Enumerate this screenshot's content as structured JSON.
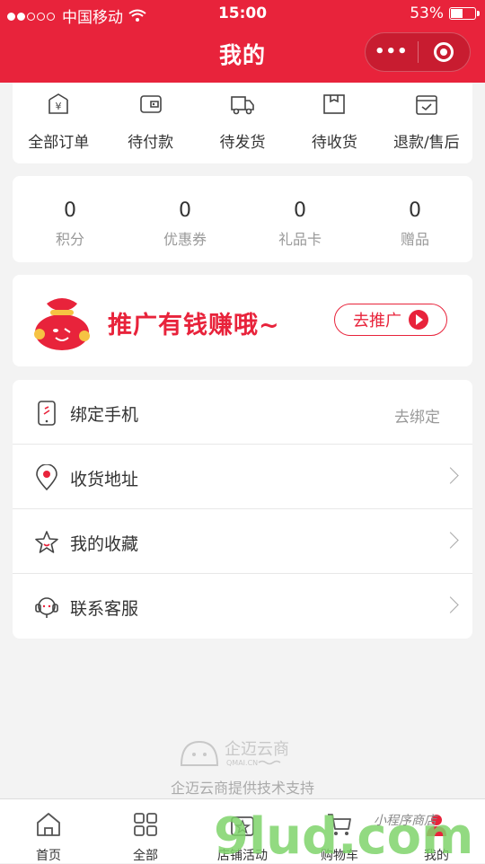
{
  "status_bar": {
    "carrier": "中国移动",
    "time": "15:00",
    "battery": "53%",
    "battery_level": 0.53
  },
  "nav": {
    "title": "我的"
  },
  "orders": [
    {
      "label": "全部订单",
      "icon": "yen-icon"
    },
    {
      "label": "待付款",
      "icon": "wallet-icon"
    },
    {
      "label": "待发货",
      "icon": "truck-icon"
    },
    {
      "label": "待收货",
      "icon": "box-icon"
    },
    {
      "label": "退款/售后",
      "icon": "calendar-check-icon"
    }
  ],
  "assets": [
    {
      "value": "0",
      "label": "积分"
    },
    {
      "value": "0",
      "label": "优惠券"
    },
    {
      "value": "0",
      "label": "礼品卡"
    },
    {
      "value": "0",
      "label": "赠品"
    }
  ],
  "promo": {
    "text": "推广有钱赚哦~",
    "button": "去推广"
  },
  "menu": [
    {
      "label": "绑定手机",
      "right_text": "去绑定",
      "icon": "phone-icon"
    },
    {
      "label": "收货地址",
      "icon": "location-pin-icon"
    },
    {
      "label": "我的收藏",
      "icon": "star-icon"
    },
    {
      "label": "联系客服",
      "icon": "headset-icon"
    }
  ],
  "footer": {
    "logo_text": "企迈云商",
    "logo_sub": "QMAI.CN",
    "support": "企迈云商提供技术支持"
  },
  "tabbar": [
    {
      "label": "首页",
      "icon": "home-icon"
    },
    {
      "label": "全部",
      "icon": "grid-icon"
    },
    {
      "label": "店铺活动",
      "icon": "store-activity-icon"
    },
    {
      "label": "购物车",
      "icon": "cart-icon"
    },
    {
      "label": "我的",
      "icon": "user-icon"
    }
  ],
  "watermark": {
    "text": "9lud.com",
    "tagline": "小程序商店"
  },
  "colors": {
    "brand": "#e8233b",
    "background": "#f3f3f3"
  }
}
